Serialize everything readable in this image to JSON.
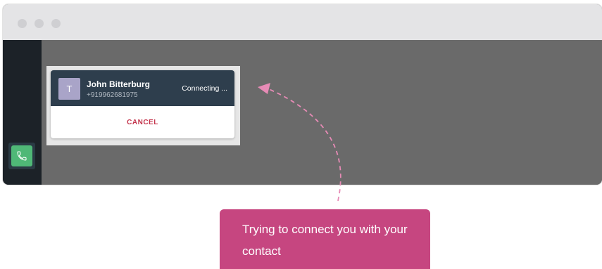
{
  "call": {
    "avatar_initial": "T",
    "caller_name": "John Bitterburg",
    "caller_number": "+919962681975",
    "status": "Connecting ...",
    "cancel_label": "CANCEL"
  },
  "sidebar": {
    "phone_button_icon": "phone-icon"
  },
  "annotation": {
    "text": "Trying to connect you with your contact",
    "color": "#c64680",
    "arrow_color": "#e78bb6"
  }
}
